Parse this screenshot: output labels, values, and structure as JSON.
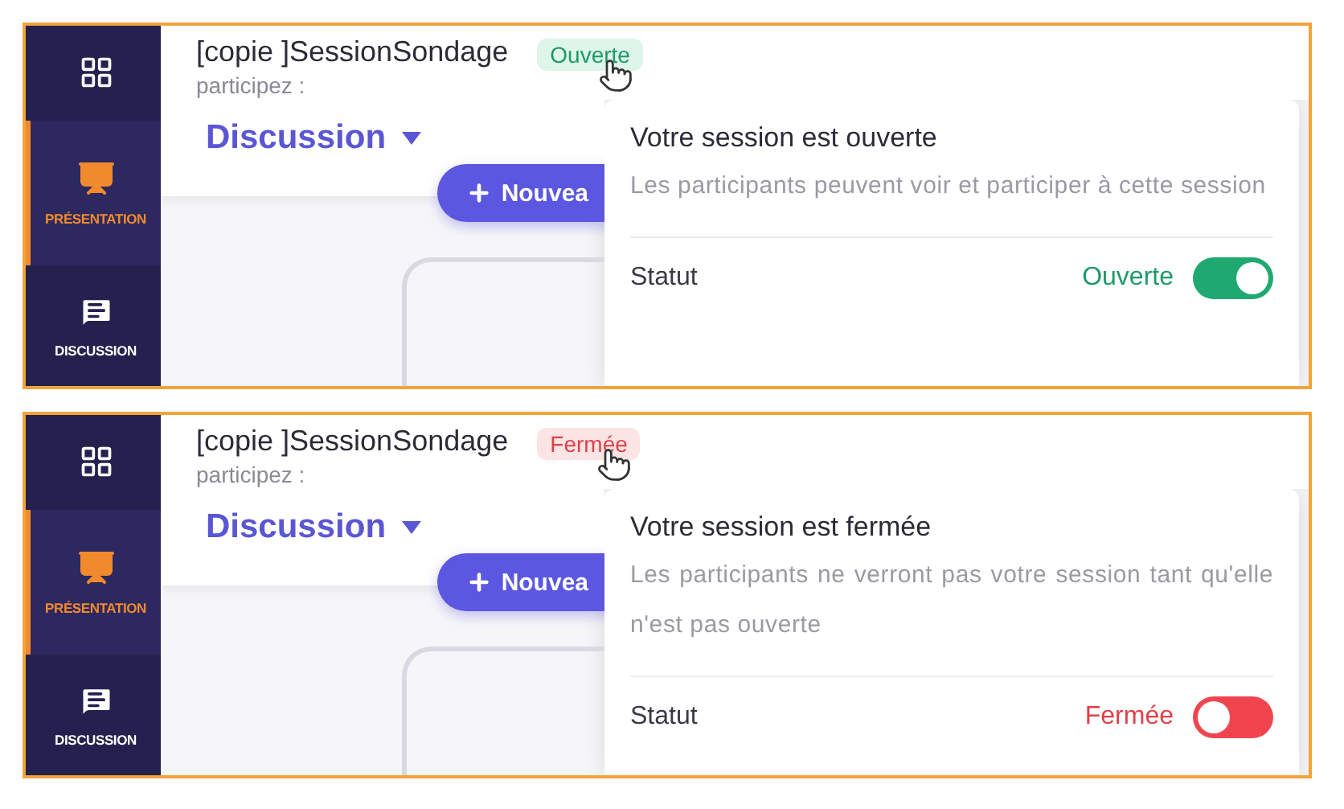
{
  "panels": [
    {
      "sidebar": {
        "items": [
          {
            "kind": "grid",
            "selected": false
          },
          {
            "kind": "presentation",
            "label": "PRÉSENTATION",
            "selected": true
          },
          {
            "kind": "discussion",
            "label": "DISCUSSION",
            "selected": false
          }
        ]
      },
      "header": {
        "title": "[copie ]SessionSondage",
        "subtitle": "participez :",
        "badge": {
          "label": "Ouverte",
          "open": true
        }
      },
      "tab": {
        "label": "Discussion"
      },
      "new_button": {
        "label": "Nouvea"
      },
      "popover": {
        "heading": "Votre session est ouverte",
        "description": "Les participants peuvent voir et participer à cette session",
        "status_label": "Statut",
        "status_value": "Ouverte",
        "toggle": {
          "on": true
        }
      }
    },
    {
      "sidebar": {
        "items": [
          {
            "kind": "grid",
            "selected": false
          },
          {
            "kind": "presentation",
            "label": "PRÉSENTATION",
            "selected": true
          },
          {
            "kind": "discussion",
            "label": "DISCUSSION",
            "selected": false
          }
        ]
      },
      "header": {
        "title": "[copie ]SessionSondage",
        "subtitle": "participez :",
        "badge": {
          "label": "Fermée",
          "open": false
        }
      },
      "tab": {
        "label": "Discussion"
      },
      "new_button": {
        "label": "Nouvea"
      },
      "popover": {
        "heading": "Votre session est fermée",
        "description": "Les participants ne verront pas votre session tant qu'elle n'est pas ouverte",
        "status_label": "Statut",
        "status_value": "Fermée",
        "toggle": {
          "on": false
        }
      }
    }
  ]
}
